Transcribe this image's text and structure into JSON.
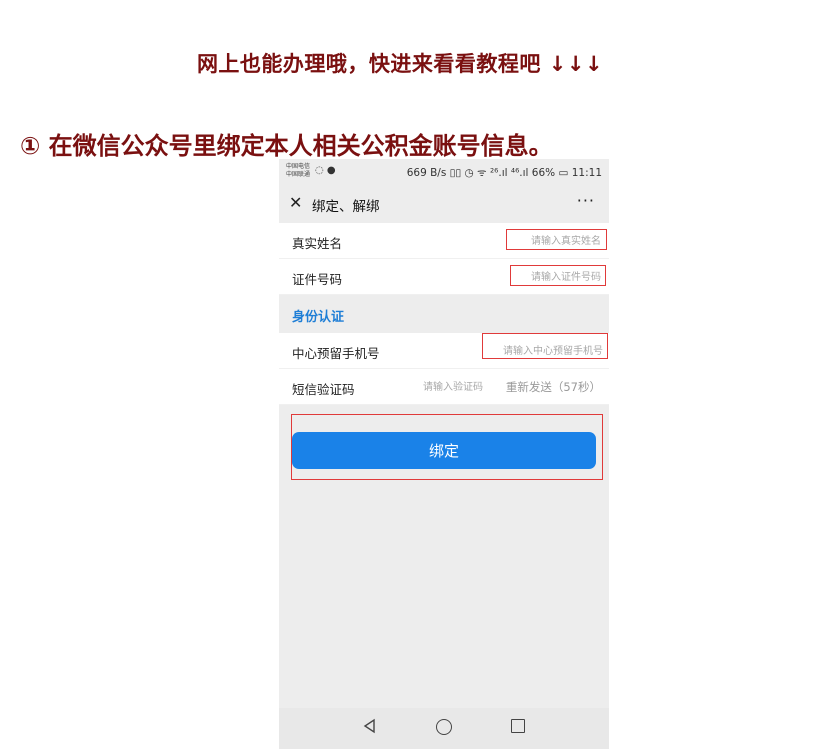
{
  "article": {
    "tip": "网上也能办理哦，快进来看看教程吧 ↓↓↓",
    "step_title": "① 在微信公众号里绑定本人相关公积金账号信息。"
  },
  "statusbar": {
    "carrier_1": "中国电信",
    "carrier_2": "中国联通",
    "right": "669 B/s ▯▯ ◷ ᯤ ²⁶.ıl ⁴⁶.ıl 66% ▭ 11:11",
    "battery": "66%",
    "time": "11:11"
  },
  "titlebar": {
    "close_icon": "close-icon",
    "title": "绑定、解绑",
    "more_icon": "more-icon"
  },
  "form": {
    "name_label": "真实姓名",
    "name_placeholder": "请输入真实姓名",
    "id_label": "证件号码",
    "id_placeholder": "请输入证件号码",
    "section_title": "身份认证",
    "phone_label": "中心预留手机号",
    "phone_placeholder": "请输入中心预留手机号",
    "sms_label": "短信验证码",
    "sms_placeholder": "请输入验证码",
    "resend_label": "重新发送（57秒）"
  },
  "bind_button": {
    "label": "绑定",
    "color": "#1a82e8"
  },
  "highlight_color": "#e03a3a",
  "navbar": {
    "icons": [
      "back-triangle-icon",
      "home-circle-icon",
      "recent-square-icon"
    ]
  }
}
